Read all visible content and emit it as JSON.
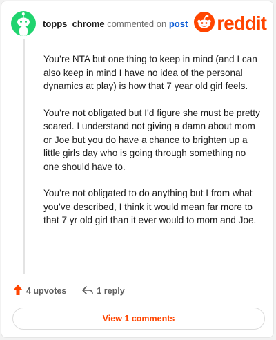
{
  "header": {
    "username": "topps_chrome",
    "action_text": "commented on",
    "post_link": "post",
    "logo_text": "reddit",
    "logo_icon": "reddit-snoo-icon",
    "avatar_icon": "snoo-avatar-icon"
  },
  "comment": {
    "paragraphs": [
      "You’re NTA but one thing to keep in mind (and I can also keep in mind I have no idea of the personal dynamics at play) is how that 7 year old girl feels.",
      "You’re not obligated but I’d figure she must be pretty scared. I understand not giving a damn about mom or Joe but you do have a chance to brighten up a little girls day who is going through something no one should have to.",
      "You’re not obligated to do anything but I from what you’ve described, I think it would mean far more to that 7 yr old girl than it ever would to mom and Joe."
    ]
  },
  "actions": {
    "upvotes_label": "4 upvotes",
    "upvote_icon": "upvote-arrow-icon",
    "reply_label": "1 reply",
    "reply_icon": "reply-arrow-icon"
  },
  "view_comments_label": "View 1 comments",
  "colors": {
    "brand": "#ff4500",
    "link": "#0a5bd6",
    "avatar": "#20d46f"
  }
}
